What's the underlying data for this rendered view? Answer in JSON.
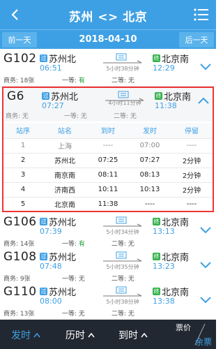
{
  "header": {
    "title": "苏州 <> 北京"
  },
  "datebar": {
    "prev": "前一天",
    "date": "2018-04-10",
    "next": "后一天"
  },
  "trains": [
    {
      "num": "G102",
      "from_badge": "过",
      "from": "苏州北",
      "dep": "06:51",
      "duration": "5小时38分钟",
      "to_badge": "终",
      "to": "北京南",
      "arr": "12:29",
      "biz": "商务: 18张",
      "first_label": "一等: ",
      "first_val": "有",
      "second": "二等: 无"
    },
    {
      "num": "G106",
      "from_badge": "过",
      "from": "苏州北",
      "dep": "07:39",
      "duration": "5小时34分钟",
      "to_badge": "终",
      "to": "北京南",
      "arr": "13:13",
      "biz": "商务: 14张",
      "first_label": "一等: ",
      "first_val": "有",
      "second": "二等: 无"
    },
    {
      "num": "G108",
      "from_badge": "过",
      "from": "苏州北",
      "dep": "07:48",
      "duration": "5小时35分钟",
      "to_badge": "终",
      "to": "北京南",
      "arr": "13:23",
      "biz": "商务: 9张",
      "first_label": "一等: ",
      "first_val": "无",
      "second": "二等: 无"
    },
    {
      "num": "G110",
      "from_badge": "过",
      "from": "苏州北",
      "dep": "08:00",
      "duration": "5小时38分钟",
      "to_badge": "终",
      "to": "北京南",
      "arr": "13:38",
      "biz": "商务: 13张",
      "first_label": "一等: ",
      "first_val": "无",
      "second": "二等: 无"
    }
  ],
  "expanded": {
    "num": "G6",
    "from_badge": "过",
    "from": "苏州北",
    "dep": "07:27",
    "duration": "4小时11分钟",
    "to_badge": "终",
    "to": "北京南",
    "arr": "11:38",
    "biz": "商务: 无",
    "first": "一等: 无",
    "second": "二等: 无",
    "stop_headers": [
      "站序",
      "站名",
      "到时",
      "发时",
      "停留"
    ],
    "stops": [
      [
        "1",
        "上海",
        "----",
        "07:00",
        "----"
      ],
      [
        "2",
        "苏州北",
        "07:25",
        "07:27",
        "2分钟"
      ],
      [
        "3",
        "南京南",
        "08:11",
        "08:13",
        "2分钟"
      ],
      [
        "4",
        "济南西",
        "10:11",
        "10:13",
        "2分钟"
      ],
      [
        "5",
        "北京南",
        "11:38",
        "----",
        "----"
      ]
    ]
  },
  "bottombar": {
    "depart": "发时",
    "duration": "历时",
    "arrive": "到时",
    "fare": "票价",
    "tickets": "余票"
  },
  "colors": {
    "primary": "#3ea0e4",
    "highlight_border": "#ee3333",
    "available": "#1f9a3a",
    "bottom_bg": "#222832"
  }
}
